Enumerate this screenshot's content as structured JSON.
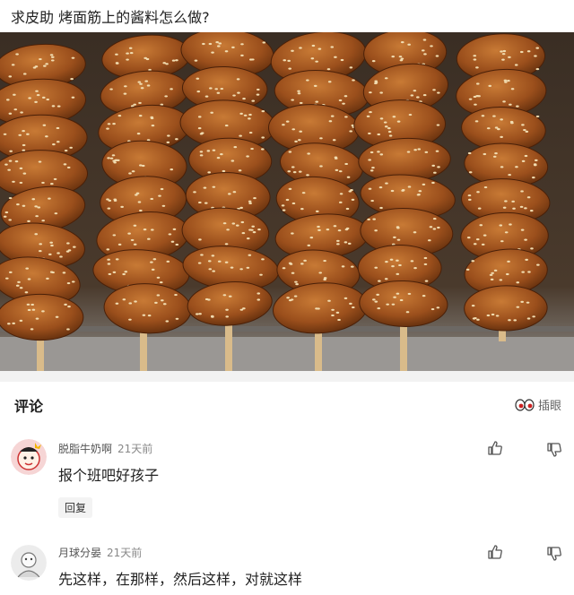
{
  "post": {
    "title": "求皮助 烤面筋上的酱料怎么做?"
  },
  "comments_section": {
    "header": "评论",
    "reaction_label": "插眼"
  },
  "comments": [
    {
      "username": "脱脂牛奶啊",
      "time": "21天前",
      "text": "报个班吧好孩子",
      "reply_label": "回复"
    },
    {
      "username": "月球分晏",
      "time": "21天前",
      "text": "先这样，在那样，然后这样，对就这样"
    }
  ],
  "icons": {
    "upvote": "thumbs-up-icon",
    "downvote": "thumbs-down-icon",
    "reaction": "eyes-icon"
  },
  "colors": {
    "food_brown": "#a2551f",
    "sesame": "#f1dcb0",
    "skewer": "#d9bb8a"
  }
}
